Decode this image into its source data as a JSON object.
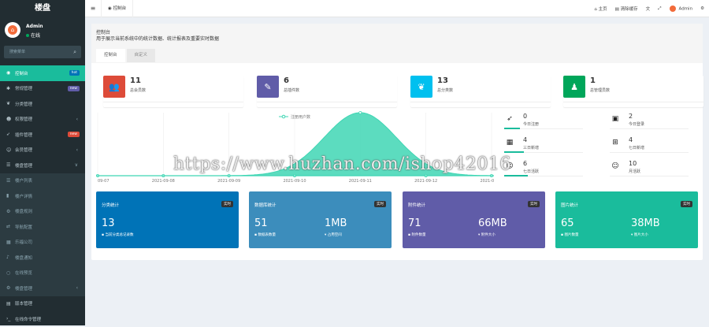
{
  "app": {
    "logo": "楼盘"
  },
  "user": {
    "name": "Admin",
    "status": "在线"
  },
  "search": {
    "placeholder": "搜索菜单"
  },
  "menu": [
    {
      "label": "控制台",
      "icon": "dashboard-icon",
      "badge": "hot",
      "badge_color": "#0073b7",
      "active": true
    },
    {
      "label": "常规管理",
      "icon": "cogs-icon",
      "badge": "new",
      "badge_color": "#605ca8"
    },
    {
      "label": "分类管理",
      "icon": "leaf-icon"
    },
    {
      "label": "权限管理",
      "icon": "group-icon",
      "arrow": "‹"
    },
    {
      "label": "插件管理",
      "icon": "rocket-icon",
      "badge": "new",
      "badge_color": "#dd4b39"
    },
    {
      "label": "会员管理",
      "icon": "user-circle-icon",
      "arrow": "‹"
    },
    {
      "label": "楼盘管理",
      "icon": "list-icon",
      "arrow": "∨"
    }
  ],
  "submenu": [
    {
      "label": "楼户列表",
      "icon": "list-icon"
    },
    {
      "label": "楼户详情",
      "icon": "bookmark-icon"
    },
    {
      "label": "楼盘规则",
      "icon": "gear-icon"
    },
    {
      "label": "导航配置",
      "icon": "random-icon"
    },
    {
      "label": "乐福公司",
      "icon": "building-icon"
    },
    {
      "label": "楼盘通知",
      "icon": "bell-icon"
    },
    {
      "label": "在线预览",
      "icon": "circle-icon"
    },
    {
      "label": "楼盘管理",
      "icon": "gear-icon",
      "arrow": "‹"
    }
  ],
  "menu_bottom": [
    {
      "label": "版本管理",
      "icon": "file-icon"
    },
    {
      "label": "在线命令管理",
      "icon": "terminal-icon"
    }
  ],
  "topbar": {
    "tab": "控制台",
    "home": "主页",
    "clear_cache": "清除缓存",
    "user": "Admin"
  },
  "panel": {
    "title": "控制台",
    "desc": "用于展示当前系统中的统计数据、统计报表及重要实时数据",
    "tabs": [
      "控制台",
      "自定义"
    ]
  },
  "cards": [
    {
      "num": "11",
      "label": "总会员数",
      "color": "#dd4b39",
      "icon": "users-icon"
    },
    {
      "num": "6",
      "label": "总插件数",
      "color": "#605ca8",
      "icon": "magic-icon"
    },
    {
      "num": "13",
      "label": "总分类数",
      "color": "#00c0ef",
      "icon": "leaf-icon"
    },
    {
      "num": "1",
      "label": "总管理员数",
      "color": "#00a65a",
      "icon": "user-icon"
    }
  ],
  "chart_data": {
    "type": "area",
    "legend": [
      "注册用户数"
    ],
    "categories": [
      "09-07",
      "2021-09-08",
      "2021-09-09",
      "2021-09-10",
      "2021-09-11",
      "2021-09-12",
      "2021-09"
    ],
    "values": [
      0,
      0,
      0,
      0,
      4,
      0,
      0
    ],
    "color": "#3fd6b4"
  },
  "side_stats": [
    {
      "num": "0",
      "label": "今日注册",
      "icon": "rocket-icon",
      "fill": 0.2
    },
    {
      "num": "2",
      "label": "今日登录",
      "icon": "vcard-icon",
      "fill": 0.0
    },
    {
      "num": "4",
      "label": "三日新增",
      "icon": "calendar-icon",
      "fill": 0.25
    },
    {
      "num": "4",
      "label": "七日新增",
      "icon": "calendar-plus-icon",
      "fill": 0.0
    },
    {
      "num": "6",
      "label": "七日活跃",
      "icon": "user-check-icon",
      "fill": 0.3
    },
    {
      "num": "10",
      "label": "月活跃",
      "icon": "user-circle-icon",
      "fill": 0.0
    }
  ],
  "big_cards": [
    {
      "title": "分类统计",
      "badge": "实时",
      "n1": "13",
      "l1": "当前分类总记录数",
      "n2": "",
      "l2": "",
      "color": "#0073b7"
    },
    {
      "title": "数据库统计",
      "badge": "实时",
      "n1": "51",
      "l1": "数据表数量",
      "n2": "1MB",
      "l2": "占用空间",
      "color": "#3c8dbc"
    },
    {
      "title": "附件统计",
      "badge": "实时",
      "n1": "71",
      "l1": "附件数量",
      "n2": "66MB",
      "l2": "附件大小",
      "color": "#605ca8"
    },
    {
      "title": "图片统计",
      "badge": "实时",
      "n1": "65",
      "l1": "图片数量",
      "n2": "38MB",
      "l2": "图片大小",
      "color": "#1abc9c"
    }
  ],
  "watermark": "https://www.huzhan.com/ishop42016"
}
